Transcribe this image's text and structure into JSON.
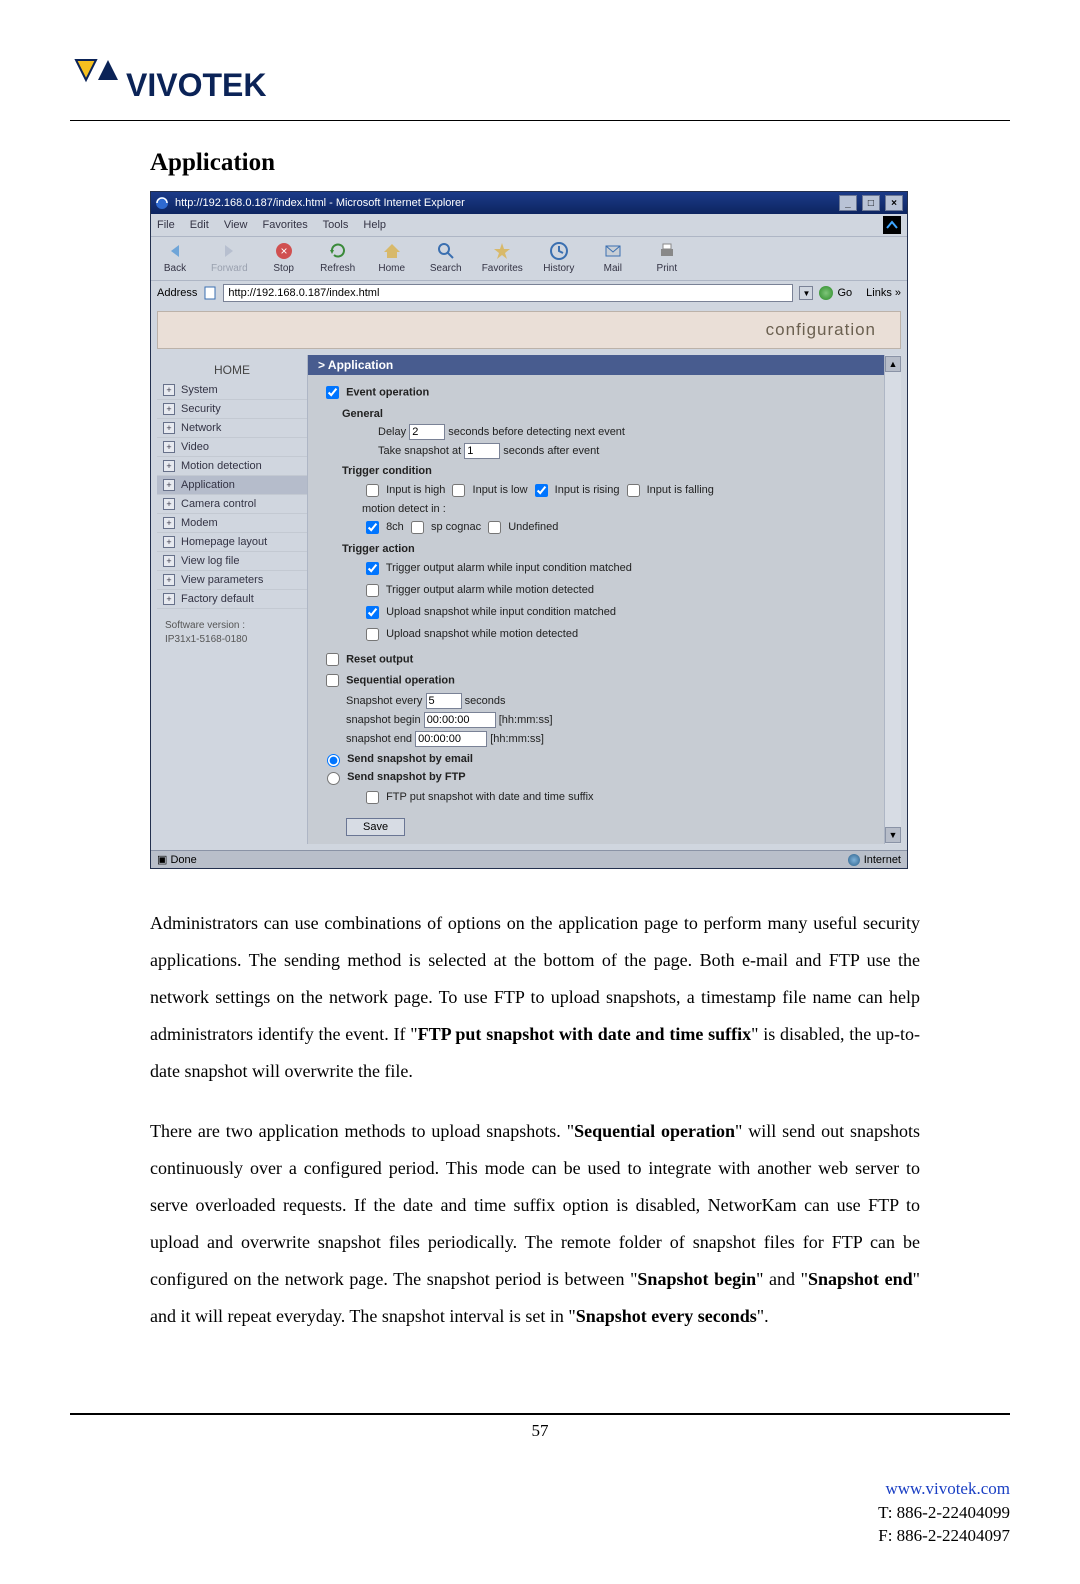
{
  "logo": {
    "brand_letter": "V",
    "brand_text": "VIVOTEK"
  },
  "section_title": "Application",
  "browser": {
    "title": "http://192.168.0.187/index.html - Microsoft Internet Explorer",
    "menu": {
      "file": "File",
      "edit": "Edit",
      "view": "View",
      "favorites": "Favorites",
      "tools": "Tools",
      "help": "Help"
    },
    "toolbar": {
      "back": "Back",
      "forward": "Forward",
      "stop": "Stop",
      "refresh": "Refresh",
      "home": "Home",
      "search": "Search",
      "favorites": "Favorites",
      "history": "History",
      "mail": "Mail",
      "print": "Print"
    },
    "address_label": "Address",
    "address_value": "http://192.168.0.187/index.html",
    "go_label": "Go",
    "links_label": "Links »",
    "status_left": "Done",
    "status_right": "Internet"
  },
  "page": {
    "banner": "configuration",
    "panel_title": "> Application",
    "sidebar": {
      "home": "HOME",
      "items": [
        "System",
        "Security",
        "Network",
        "Video",
        "Motion detection",
        "Application",
        "Camera control",
        "Modem",
        "Homepage layout",
        "View log file",
        "View parameters",
        "Factory default"
      ],
      "selected_index": 5,
      "sw_label": "Software version :",
      "sw_value": "IP31x1-5168-0180"
    },
    "form": {
      "event_operation": "Event operation",
      "general": "General",
      "delay_before": "Delay",
      "delay_before_val": "2",
      "delay_after_txt": "seconds before detecting next event",
      "take_snapshot_at": "Take snapshot at",
      "take_snapshot_at_val": "1",
      "seconds_after_event": "seconds after event",
      "trigger_condition": "Trigger condition",
      "tc_high": "Input is high",
      "tc_low": "Input is low",
      "tc_rising": "Input is rising",
      "tc_falling": "Input is falling",
      "motion_detect_in": "motion detect in :",
      "md_8ch": "8ch",
      "md_sp_cognac": "sp cognac",
      "md_undefined": "Undefined",
      "trigger_action": "Trigger action",
      "ta_out_input": "Trigger output alarm while input condition matched",
      "ta_out_motion": "Trigger output alarm while motion detected",
      "ta_up_input": "Upload snapshot while input condition matched",
      "ta_up_motion": "Upload snapshot while motion detected",
      "reset_output": "Reset output",
      "sequential": "Sequential operation",
      "snap_every": "Snapshot every",
      "snap_every_val": "5",
      "snap_every_unit": "seconds",
      "snap_begin": "snapshot begin",
      "snap_begin_val": "00:00:00",
      "snap_fmt": "[hh:mm:ss]",
      "snap_end": "snapshot end",
      "snap_end_val": "00:00:00",
      "send_email": "Send snapshot by email",
      "send_ftp": "Send snapshot by FTP",
      "ftp_suffix": "FTP put snapshot with date and time suffix",
      "save": "Save"
    }
  },
  "paragraph1": "Administrators can use combinations of options on the application page to perform many useful security applications. The sending method is selected at the bottom of the page. Both e-mail and FTP use the network settings on the network page. To use FTP to upload snapshots, a timestamp file name can help administrators identify the event. If \"FTP put snapshot with date and time suffix\" is disabled, the up-to-date snapshot will overwrite the file.",
  "paragraph2_part1": "There are two application methods to upload snapshots. \"",
  "paragraph2_seq": "Sequential operation",
  "paragraph2_part2": "\" will send out snapshots continuously over a configured period. This mode can be used to integrate with another web server to serve overloaded requests. If the date and time suffix option is disabled, NetworKam can use FTP to upload and overwrite snapshot files periodically. The remote folder of snapshot files for FTP can be configured on the network page. The snapshot period is between \"",
  "paragraph2_begin": "Snapshot begin",
  "paragraph2_part3": "\" and \"",
  "paragraph2_end": "Snapshot end",
  "paragraph2_part4": "\" and it will repeat everyday. The snapshot interval is set in \"",
  "paragraph2_every": "Snapshot every seconds",
  "paragraph2_part5": "\".",
  "page_number": "57",
  "footer": {
    "url": "www.vivotek.com",
    "tel": "T: 886-2-22404099",
    "fax": "F: 886-2-22404097"
  }
}
